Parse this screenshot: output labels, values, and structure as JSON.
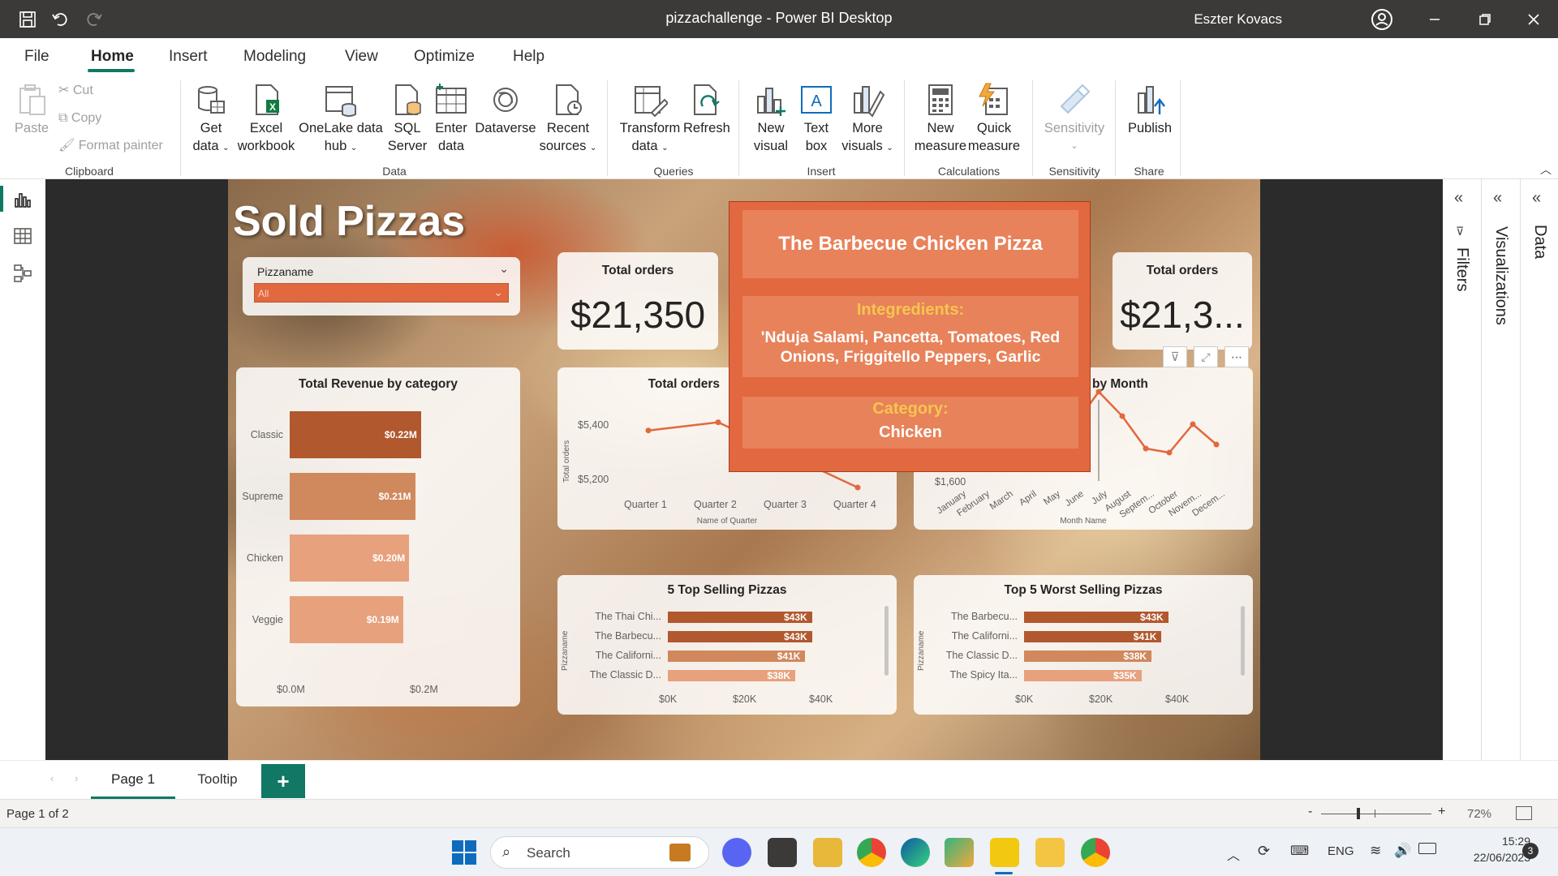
{
  "window": {
    "title": "pizzachallenge - Power BI Desktop",
    "user": "Eszter Kovacs"
  },
  "menu": [
    "File",
    "Home",
    "Insert",
    "Modeling",
    "View",
    "Optimize",
    "Help"
  ],
  "ribbon": {
    "clipboard": {
      "paste": "Paste",
      "cut": "Cut",
      "copy": "Copy",
      "format_painter": "Format painter",
      "label": "Clipboard"
    },
    "data": {
      "get_data": "Get",
      "get_data2": "data",
      "excel": "Excel",
      "excel2": "workbook",
      "onelake": "OneLake data",
      "onelake2": "hub",
      "sql": "SQL",
      "sql2": "Server",
      "enter": "Enter",
      "enter2": "data",
      "dataverse": "Dataverse",
      "recent": "Recent",
      "recent2": "sources",
      "label": "Data"
    },
    "queries": {
      "transform": "Transform",
      "transform2": "data",
      "refresh": "Refresh",
      "label": "Queries"
    },
    "insert": {
      "new_visual": "New",
      "new_visual2": "visual",
      "text_box": "Text",
      "text_box2": "box",
      "more_visuals": "More",
      "more_visuals2": "visuals",
      "label": "Insert"
    },
    "calculations": {
      "new_measure": "New",
      "new_measure2": "measure",
      "quick_measure": "Quick",
      "quick_measure2": "measure",
      "label": "Calculations"
    },
    "sensitivity": {
      "btn": "Sensitivity",
      "label": "Sensitivity"
    },
    "share": {
      "publish": "Publish",
      "label": "Share"
    }
  },
  "report": {
    "title": "Sold Pizzas",
    "slicer": {
      "label": "Pizzaname",
      "value": "All"
    },
    "card1": {
      "title": "Total orders",
      "value": "$21,350"
    },
    "card2": {
      "title": "Total orders",
      "value": "$21,3..."
    },
    "revenue": {
      "title": "Total Revenue by category",
      "x_ticks": [
        "$0.0M",
        "$0.2M"
      ]
    },
    "quarter": {
      "title": "Total orders",
      "y_label": "Total orders",
      "x_label": "Name of Quarter",
      "y_ticks": [
        "$5,400",
        "$5,200"
      ]
    },
    "month": {
      "title": "by Month",
      "x_label": "Month Name",
      "y_tick": "$1,600"
    },
    "top5": {
      "title": "5 Top Selling Pizzas",
      "y_label": "Pizzaname",
      "x_ticks": [
        "$0K",
        "$20K",
        "$40K"
      ]
    },
    "worst5": {
      "title": "Top 5 Worst Selling Pizzas",
      "y_label": "Pizzaname",
      "x_ticks": [
        "$0K",
        "$20K",
        "$40K"
      ]
    }
  },
  "tooltip": {
    "pizza": "The Barbecue Chicken Pizza",
    "ingredients_label": "Integredients:",
    "ingredients": "'Nduja Salami, Pancetta, Tomatoes, Red Onions, Friggitello Peppers, Garlic",
    "category_label": "Category:",
    "category": "Chicken"
  },
  "panes": {
    "filters": "Filters",
    "visualizations": "Visualizations",
    "data": "Data"
  },
  "pages": {
    "tabs": [
      "Page 1",
      "Tooltip"
    ],
    "add": "+"
  },
  "status": {
    "page": "Page 1 of 2",
    "zoom": "72%",
    "minus": "-",
    "plus": "+"
  },
  "taskbar": {
    "search": "Search",
    "lang": "ENG",
    "time": "15:29",
    "date": "22/06/2023",
    "badge": "3"
  },
  "colors": {
    "accent": "#e2683f",
    "teal": "#117865",
    "bar_dark": "#b1582f",
    "bar_mid": "#d0885d",
    "bar_light": "#e7a17d"
  },
  "chart_data": [
    {
      "type": "bar",
      "title": "Total Revenue by category",
      "categories": [
        "Classic",
        "Supreme",
        "Chicken",
        "Veggie"
      ],
      "values": [
        0.22,
        0.21,
        0.2,
        0.19
      ],
      "labels": [
        "$0.22M",
        "$0.21M",
        "$0.20M",
        "$0.19M"
      ],
      "xlim": [
        0,
        0.28
      ],
      "unit": "M"
    },
    {
      "type": "line",
      "title": "Total orders",
      "categories": [
        "Quarter 1",
        "Quarter 2",
        "Quarter 3",
        "Quarter 4"
      ],
      "values": [
        5380,
        5410,
        null,
        5170
      ],
      "ylabel": "Total orders",
      "xlabel": "Name of Quarter"
    },
    {
      "type": "line",
      "title": "by Month",
      "categories": [
        "January",
        "February",
        "March",
        "April",
        "May",
        "June",
        "July",
        "August",
        "Septem...",
        "October",
        "Novem...",
        "Decem..."
      ],
      "values": [
        null,
        null,
        null,
        null,
        null,
        1740,
        1820,
        1760,
        1680,
        1670,
        1740,
        1690
      ],
      "xlabel": "Month Name"
    },
    {
      "type": "bar",
      "title": "5 Top Selling Pizzas",
      "categories": [
        "The Thai Chi...",
        "The Barbecu...",
        "The Californi...",
        "The Classic D..."
      ],
      "values": [
        43,
        43,
        41,
        38
      ],
      "labels": [
        "$43K",
        "$43K",
        "$41K",
        "$38K"
      ],
      "xlim": [
        0,
        45
      ]
    },
    {
      "type": "bar",
      "title": "Top 5 Worst Selling Pizzas",
      "categories": [
        "The Barbecu...",
        "The Californi...",
        "The Classic D...",
        "The Spicy Ita..."
      ],
      "values": [
        43,
        41,
        38,
        35
      ],
      "labels": [
        "$43K",
        "$41K",
        "$38K",
        "$35K"
      ],
      "xlim": [
        0,
        45
      ]
    }
  ]
}
